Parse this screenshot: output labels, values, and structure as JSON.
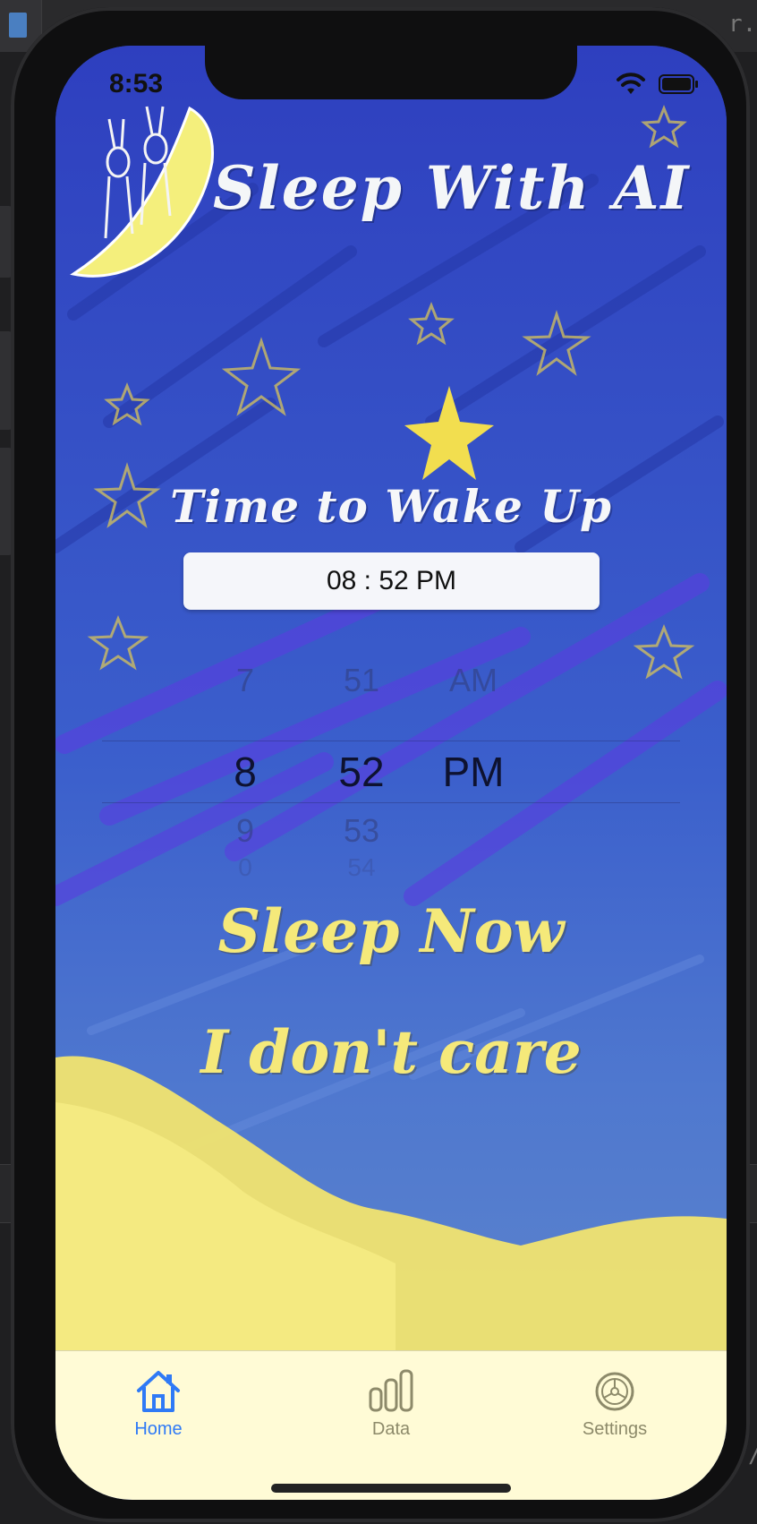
{
  "status_bar": {
    "time": "8:53",
    "icons": [
      "wifi-icon",
      "battery-icon"
    ]
  },
  "app": {
    "title": "Sleep With AI",
    "logo": "moon-rabbits-illustration"
  },
  "wake": {
    "label": "Time to Wake Up",
    "field_value": "08 : 52 PM"
  },
  "picker": {
    "hours": {
      "above": "7",
      "selected": "8",
      "below": "9",
      "far_below": "0"
    },
    "minutes": {
      "above": "51",
      "selected": "52",
      "below": "53",
      "far_below": "54"
    },
    "period": {
      "above": "AM",
      "selected": "PM"
    }
  },
  "actions": {
    "sleep_now": "Sleep Now",
    "dont_care": "I don't care"
  },
  "tabbar": {
    "items": [
      {
        "label": "Home",
        "icon": "house-icon",
        "active": true
      },
      {
        "label": "Data",
        "icon": "bar-chart-icon",
        "active": false
      },
      {
        "label": "Settings",
        "icon": "gear-icon",
        "active": false
      }
    ]
  },
  "colors": {
    "background_blue": "#3a56c8",
    "accent_yellow": "#f5e97a",
    "tab_active": "#2f7af6",
    "tab_inactive": "#8d8a6a",
    "tabbar_bg": "#fffbd6"
  }
}
